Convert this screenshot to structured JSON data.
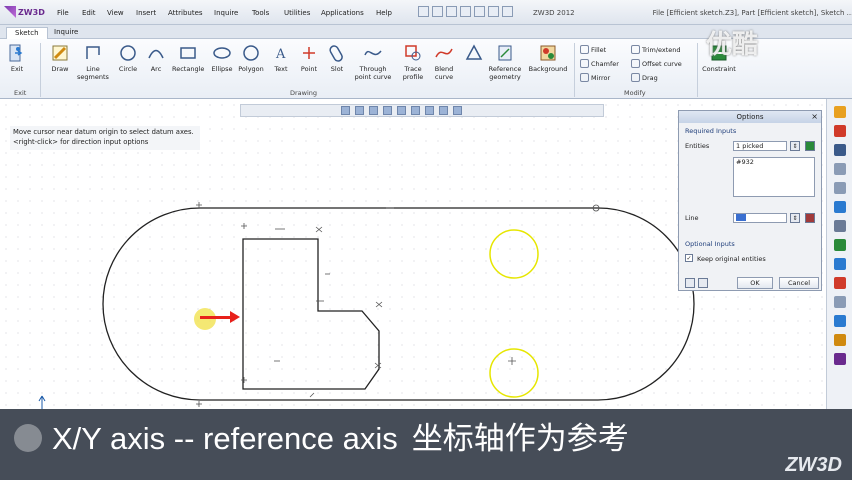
{
  "app": {
    "logo": "ZW3D",
    "title": "ZW3D 2012",
    "doc_title": "File [Efficient sketch.Z3], Part [Efficient sketch], Sketch ..."
  },
  "menu": [
    "File",
    "Edit",
    "View",
    "Insert",
    "Attributes",
    "Inquire",
    "Tools",
    "Utilities",
    "Applications",
    "Help"
  ],
  "tabs": [
    "Sketch",
    "Inquire"
  ],
  "ribbon": {
    "exit": {
      "label": "Exit",
      "group": "Exit"
    },
    "drawing": [
      {
        "label": "Draw",
        "icon": "pencil-icon"
      },
      {
        "label": "Line segments",
        "icon": "line-icon"
      },
      {
        "label": "Circle",
        "icon": "circle-icon"
      },
      {
        "label": "Arc",
        "icon": "arc-icon"
      },
      {
        "label": "Rectangle",
        "icon": "rectangle-icon"
      },
      {
        "label": "Ellipse",
        "icon": "ellipse-icon"
      },
      {
        "label": "Polygon",
        "icon": "polygon-icon"
      },
      {
        "label": "Text",
        "icon": "text-icon"
      },
      {
        "label": "Point",
        "icon": "point-icon"
      },
      {
        "label": "Slot",
        "icon": "slot-icon"
      },
      {
        "label": "Through point curve",
        "icon": "spline-icon"
      },
      {
        "label": "Trace profile",
        "icon": "trace-icon"
      },
      {
        "label": "Blend curve",
        "icon": "blend-icon"
      },
      {
        "label": "Reference geometry",
        "icon": "reference-icon"
      },
      {
        "label": "Background",
        "icon": "background-icon"
      }
    ],
    "drawing_group": "Drawing",
    "modify": [
      {
        "label": "Fillet",
        "icon": "fillet-icon"
      },
      {
        "label": "Chamfer",
        "icon": "chamfer-icon"
      },
      {
        "label": "Mirror",
        "icon": "mirror-icon"
      },
      {
        "label": "Trim/extend",
        "icon": "trim-icon"
      },
      {
        "label": "Offset curve",
        "icon": "offset-icon"
      },
      {
        "label": "Drag",
        "icon": "drag-icon"
      }
    ],
    "modify_group": "Modify",
    "constraint": {
      "label": "Constraint"
    }
  },
  "hint": {
    "line1": "Move cursor near datum origin to select datum axes.",
    "line2": "<right-click> for direction input options"
  },
  "options_panel": {
    "title": "Options",
    "required_label": "Required Inputs",
    "entities_label": "Entities",
    "entities_value": "1 picked",
    "entity_list": "#932",
    "line_label": "Line",
    "optional_label": "Optional Inputs",
    "keep_label": "Keep original entities",
    "keep_checked": true,
    "ok_label": "OK",
    "cancel_label": "Cancel"
  },
  "caption": {
    "english": "X/Y axis -- reference axis",
    "chinese": "坐标轴作为参考"
  },
  "brand": "ZW3D",
  "watermark": "优酷",
  "colors": {
    "caption_bg": "#28303c",
    "highlight_circle": "#e6e600",
    "arrow": "#e8201a",
    "ribbon_bg": "#eef2f7"
  }
}
